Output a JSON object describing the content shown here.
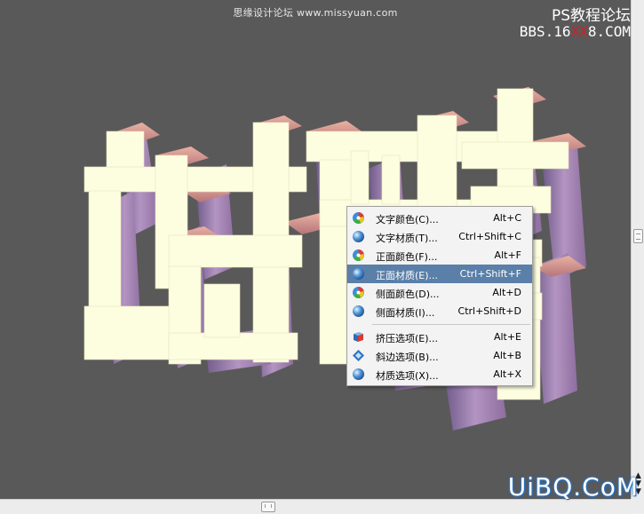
{
  "watermark": {
    "top": "思缘设计论坛 www.missyuan.com",
    "right_line1": "PS教程论坛",
    "right_line2_a": "BBS.16",
    "right_line2_b": "XX",
    "right_line2_c": "8.COM"
  },
  "brand": "UiBQ.CoM",
  "context_menu": {
    "items": [
      {
        "label": "文字颜色(C)...",
        "shortcut": "Alt+C",
        "icon": "color-wheel-icon"
      },
      {
        "label": "文字材质(T)...",
        "shortcut": "Ctrl+Shift+C",
        "icon": "material-sphere-icon"
      },
      {
        "label": "正面颜色(F)...",
        "shortcut": "Alt+F",
        "icon": "color-wheel-icon"
      },
      {
        "label": "正面材质(E)...",
        "shortcut": "Ctrl+Shift+F",
        "icon": "material-sphere-icon",
        "highlighted": true
      },
      {
        "label": "侧面颜色(D)...",
        "shortcut": "Alt+D",
        "icon": "color-wheel-icon"
      },
      {
        "label": "侧面材质(I)...",
        "shortcut": "Ctrl+Shift+D",
        "icon": "material-sphere-icon"
      },
      {
        "label": "挤压选项(E)...",
        "shortcut": "Alt+E",
        "icon": "extrude-cube-icon"
      },
      {
        "label": "斜边选项(B)...",
        "shortcut": "Alt+B",
        "icon": "bevel-icon"
      },
      {
        "label": "材质选项(X)...",
        "shortcut": "Alt+X",
        "icon": "material-sphere-icon"
      }
    ]
  },
  "colors": {
    "canvas_bg": "#595959",
    "text_face": "#fdfde0",
    "side_face": "#9d7aa6",
    "bevel_top": "#d89a8a",
    "menu_highlight": "#5a7fa8"
  }
}
